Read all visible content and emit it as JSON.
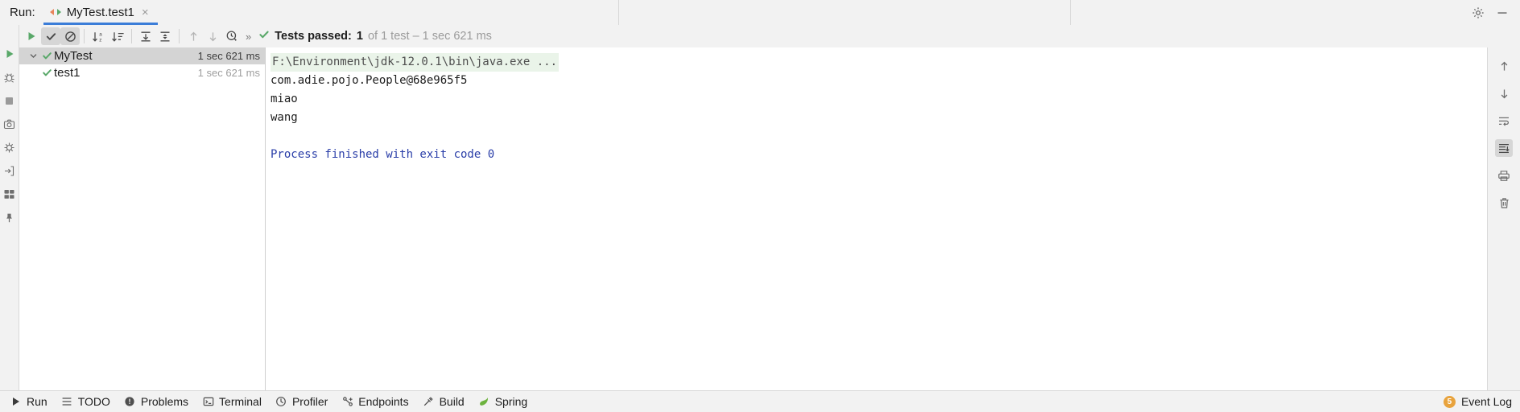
{
  "window": {
    "run_label": "Run:",
    "tab": {
      "title": "MyTest.test1",
      "close": "×",
      "icon": "rerun-arrows-icon"
    },
    "controls": {
      "settings": "gear-icon",
      "minimize": "minimize-icon"
    }
  },
  "left_strip": {
    "items": [
      {
        "icon": "run-icon"
      },
      {
        "icon": "debug-icon"
      },
      {
        "icon": "stop-icon"
      },
      {
        "icon": "camera-icon"
      },
      {
        "icon": "thread-dump-icon"
      },
      {
        "icon": "export-icon"
      },
      {
        "icon": "layout-icon"
      },
      {
        "icon": "pin-icon"
      }
    ]
  },
  "toolbar": {
    "buttons": [
      {
        "name": "rerun-button",
        "icon": "play-icon",
        "state": "normal"
      },
      {
        "name": "show-passed-button",
        "icon": "check-icon",
        "state": "toggled"
      },
      {
        "name": "show-ignored-button",
        "icon": "no-entry-icon",
        "state": "toggled"
      },
      {
        "name": "sort-alphabetically-button",
        "icon": "sort-alpha-icon",
        "state": "normal"
      },
      {
        "name": "sort-by-duration-button",
        "icon": "sort-duration-icon",
        "state": "normal"
      },
      {
        "name": "expand-all-button",
        "icon": "expand-all-icon",
        "state": "normal"
      },
      {
        "name": "collapse-all-button",
        "icon": "collapse-all-icon",
        "state": "normal"
      },
      {
        "name": "previous-failed-button",
        "icon": "arrow-up-icon",
        "state": "disabled"
      },
      {
        "name": "next-failed-button",
        "icon": "arrow-down-icon",
        "state": "disabled"
      },
      {
        "name": "test-history-button",
        "icon": "history-clock-icon",
        "state": "normal"
      }
    ],
    "overflow": "»"
  },
  "status": {
    "icon": "check-icon",
    "passed_label": "Tests passed:",
    "passed_count": "1",
    "detail": "of 1 test – 1 sec 621 ms"
  },
  "tree": {
    "rows": [
      {
        "name": "MyTest",
        "duration": "1 sec 621 ms",
        "selected": true,
        "child": false,
        "expanded": true,
        "icon": "check-icon"
      },
      {
        "name": "test1",
        "duration": "1 sec 621 ms",
        "selected": false,
        "child": true,
        "expanded": false,
        "icon": "check-icon"
      }
    ]
  },
  "console": {
    "lines": [
      {
        "text": "F:\\Environment\\jdk-12.0.1\\bin\\java.exe ...",
        "style": "path"
      },
      {
        "text": "com.adie.pojo.People@68e965f5",
        "style": "out"
      },
      {
        "text": "miao",
        "style": "out"
      },
      {
        "text": "wang",
        "style": "out"
      },
      {
        "text": "",
        "style": "blank"
      },
      {
        "text": "Process finished with exit code 0",
        "style": "fin"
      }
    ]
  },
  "right_strip": {
    "items": [
      {
        "icon": "scroll-up-icon",
        "state": "normal"
      },
      {
        "icon": "scroll-down-icon",
        "state": "normal"
      },
      {
        "icon": "soft-wrap-icon",
        "state": "normal"
      },
      {
        "icon": "scroll-to-end-icon",
        "state": "toggled"
      },
      {
        "icon": "print-icon",
        "state": "normal"
      },
      {
        "icon": "trash-icon",
        "state": "normal"
      }
    ]
  },
  "statusbar": {
    "items": [
      {
        "label": "Run",
        "icon": "run-triangle-icon"
      },
      {
        "label": "TODO",
        "icon": "todo-list-icon"
      },
      {
        "label": "Problems",
        "icon": "problems-icon"
      },
      {
        "label": "Terminal",
        "icon": "terminal-icon"
      },
      {
        "label": "Profiler",
        "icon": "profiler-icon"
      },
      {
        "label": "Endpoints",
        "icon": "endpoints-icon"
      },
      {
        "label": "Build",
        "icon": "build-hammer-icon"
      },
      {
        "label": "Spring",
        "icon": "spring-leaf-icon"
      }
    ],
    "event_log": {
      "label": "Event Log",
      "badge": "5"
    }
  }
}
